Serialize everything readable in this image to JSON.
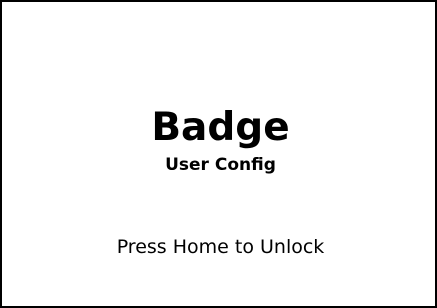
{
  "screen": {
    "title": "Badge",
    "subtitle": "User Config",
    "prompt": "Press Home to Unlock"
  },
  "colors": {
    "background": "#ffffff",
    "text": "#000000",
    "border": "#000000"
  }
}
